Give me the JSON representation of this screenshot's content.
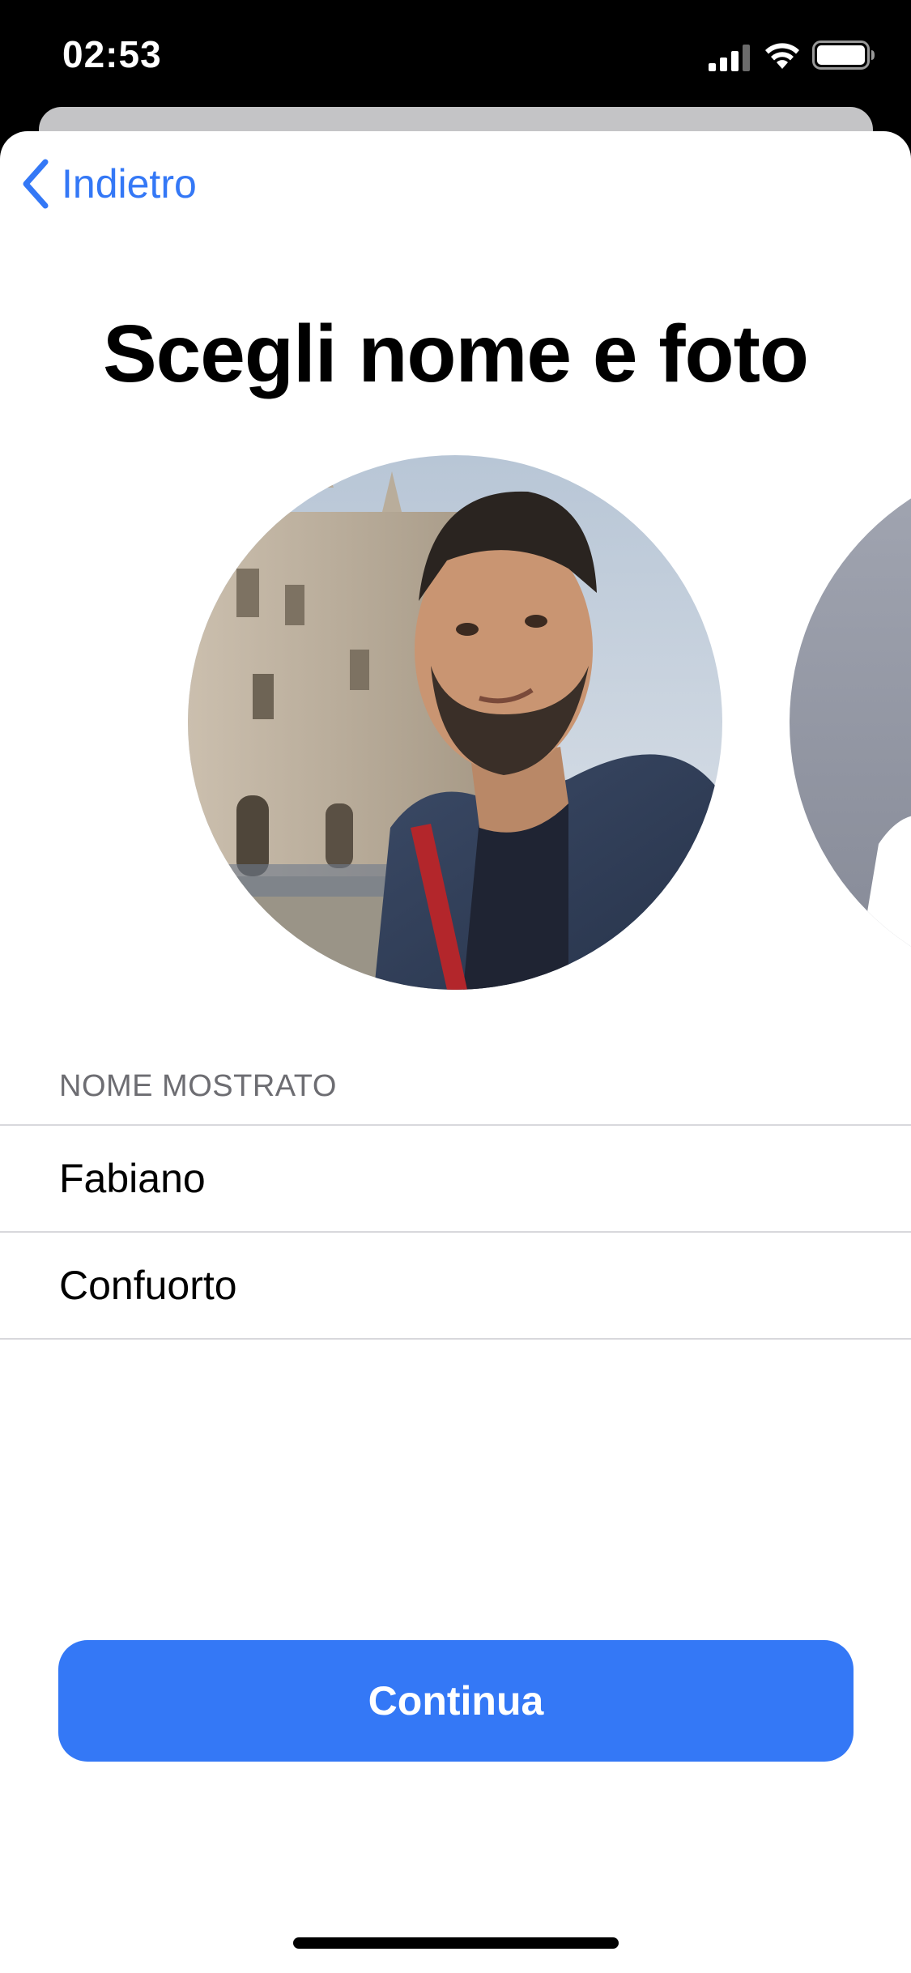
{
  "status_bar": {
    "time": "02:53",
    "icons": [
      "cellular-signal-icon",
      "wifi-icon",
      "battery-icon"
    ]
  },
  "nav": {
    "back_label": "Indietro",
    "back_icon": "chevron-left-icon"
  },
  "page": {
    "title": "Scegli nome e foto"
  },
  "profile": {
    "avatar_main": "profile-photo",
    "avatar_next": "memoji-placeholder"
  },
  "form": {
    "section_header": "NOME MOSTRATO",
    "first_name": "Fabiano",
    "last_name": "Confuorto"
  },
  "actions": {
    "continue_label": "Continua"
  },
  "colors": {
    "accent": "#3478f6",
    "background": "#ffffff",
    "section_text": "#6d6d72"
  }
}
